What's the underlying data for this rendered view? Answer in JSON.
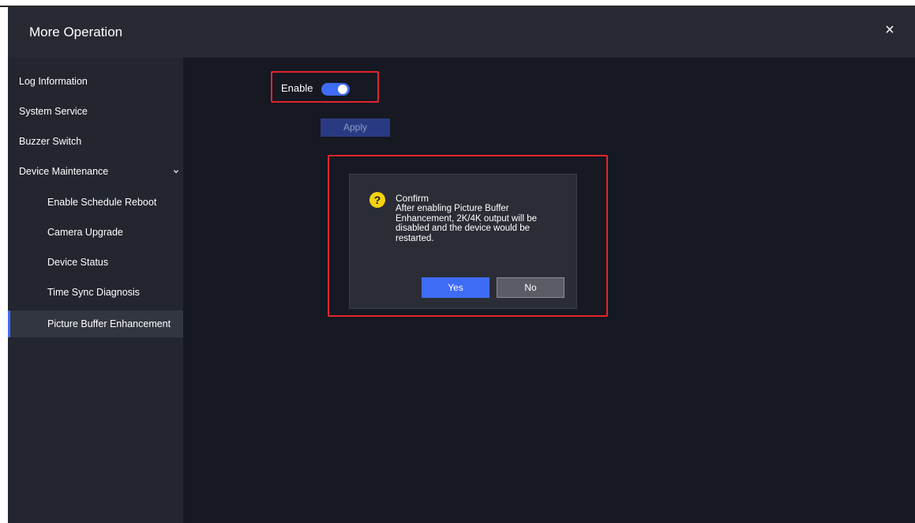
{
  "window": {
    "title": "More Operation",
    "close_label": "×"
  },
  "sidebar": {
    "items": [
      {
        "label": "Log Information"
      },
      {
        "label": "System Service"
      },
      {
        "label": "Buzzer Switch"
      },
      {
        "label": "Device Maintenance"
      },
      {
        "label": "Enable Schedule Reboot"
      },
      {
        "label": "Camera Upgrade"
      },
      {
        "label": "Device Status"
      },
      {
        "label": "Time Sync Diagnosis"
      },
      {
        "label": "Picture Buffer Enhancement"
      }
    ]
  },
  "content": {
    "enable_label": "Enable",
    "enable_on": true,
    "apply_label": "Apply"
  },
  "dialog": {
    "title": "Confirm",
    "message": "After enabling Picture Buffer Enhancement, 2K/4K output will be disabled and the device would be restarted.",
    "yes_label": "Yes",
    "no_label": "No"
  },
  "colors": {
    "accent": "#3f6cf5",
    "highlight_border": "#e0262b",
    "warning_icon": "#f5d210"
  }
}
